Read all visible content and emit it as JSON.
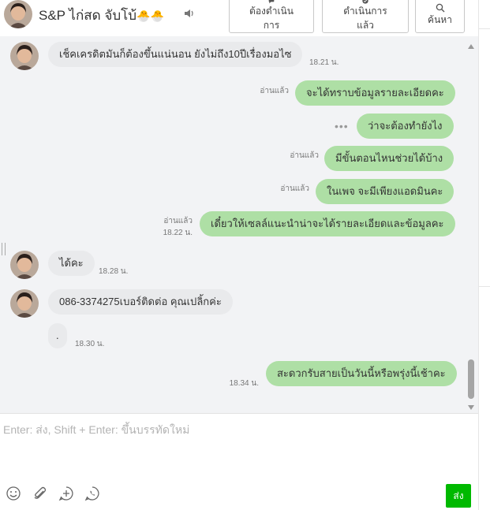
{
  "header": {
    "name": "S&P ไก่สด จับโบ้",
    "emoji": "🐣🐣",
    "buttons": [
      {
        "label": "ต้องดำเนินการ",
        "icon": "speech-bubble-icon"
      },
      {
        "label": "ดำเนินการแล้ว",
        "icon": "check-bubble-icon"
      },
      {
        "label": "ค้นหา",
        "icon": "search-icon"
      }
    ]
  },
  "messages": [
    {
      "dir": "in",
      "text": "เช็คเครดิตมันก็ต้องขึ้นแน่นอน ยังไม่ถึง10ปีเรื่องมอไซ",
      "time": "18.21 น."
    },
    {
      "dir": "out",
      "text": "จะได้ทราบข้อมูลรายละเอียดคะ",
      "read": "อ่านแล้ว"
    },
    {
      "dir": "out",
      "text": "ว่าจะต้องทำยังไง",
      "typing": "•••"
    },
    {
      "dir": "out",
      "text": "มีขั้นตอนไหนช่วยได้บ้าง",
      "read": "อ่านแล้ว"
    },
    {
      "dir": "out",
      "text": "ในเพจ จะมีเพียงแอดมินคะ",
      "read": "อ่านแล้ว"
    },
    {
      "dir": "out",
      "text": "เดี๋ยวให้เซลล์แนะนำน่าจะได้รายละเอียดและข้อมูลคะ",
      "read": "อ่านแล้ว",
      "time": "18.22 น."
    },
    {
      "dir": "in",
      "text": "ได้คะ",
      "time": "18.28 น."
    },
    {
      "dir": "in",
      "text": "086-3374275เบอร์ติดต่อ คุณเปลิ้กค่ะ"
    },
    {
      "dir": "in",
      "text": ".",
      "time": "18.30 น."
    },
    {
      "dir": "out",
      "text": "สะดวกรับสายเป็นวันนี้หรือพรุ่งนี้เช้าคะ",
      "time": "18.34 น."
    }
  ],
  "composer": {
    "placeholder": "Enter: ส่ง, Shift + Enter: ขึ้นบรรทัดใหม่",
    "send_label": "ส่ง",
    "tools": [
      "smiley-icon",
      "paperclip-icon",
      "add-bubble-icon",
      "phone-bubble-icon"
    ]
  },
  "colors": {
    "outgoing_bubble": "#aedfa5",
    "incoming_bubble": "#e9eaec",
    "send_button": "#00b900",
    "chat_background": "#f2f3f5"
  }
}
